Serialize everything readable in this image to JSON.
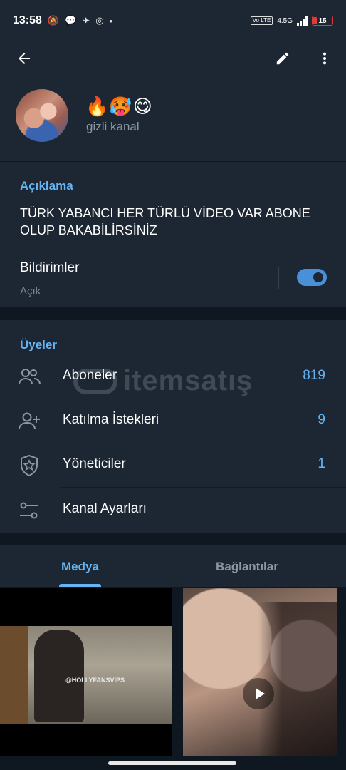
{
  "status_bar": {
    "time": "13:58",
    "network": "4.5G",
    "volte": "Vo LTE",
    "battery": "15"
  },
  "channel": {
    "name_emojis": "🔥🥵😋",
    "subtitle": "gizli kanal"
  },
  "info": {
    "section_title": "Açıklama",
    "description": "TÜRK YABANCI HER TÜRLÜ VİDEO VAR ABONE OLUP BAKABİLİRSİNİZ",
    "notifications_label": "Bildirimler",
    "notifications_state": "Açık",
    "notifications_on": true
  },
  "members": {
    "section_title": "Üyeler",
    "rows": [
      {
        "label": "Aboneler",
        "count": "819",
        "icon": "people-icon"
      },
      {
        "label": "Katılma İstekleri",
        "count": "9",
        "icon": "person-add-icon"
      },
      {
        "label": "Yöneticiler",
        "count": "1",
        "icon": "admin-shield-icon"
      },
      {
        "label": "Kanal Ayarları",
        "count": "",
        "icon": "sliders-icon"
      }
    ]
  },
  "watermark": {
    "text": "itemsatış"
  },
  "tabs": {
    "media": "Medya",
    "links": "Bağlantılar",
    "active": "media"
  },
  "media": {
    "thumb1_watermark": "@HOLLYFANSVIPS"
  },
  "colors": {
    "accent": "#64b5f6",
    "card_bg": "#1d2733",
    "page_bg": "#0f1720",
    "muted_text": "#8a97a5",
    "toggle": "#4a90d9"
  }
}
